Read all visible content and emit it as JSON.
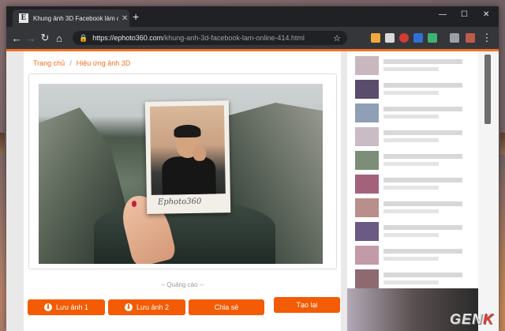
{
  "browser": {
    "tab_title": "Khung ảnh 3D Facebook làm onl",
    "url_host": "https://ephoto360.com",
    "url_path": "/khung-anh-3d-facebook-lam-online-414.html"
  },
  "breadcrumb": {
    "home": "Trang chủ",
    "separator": "/",
    "current": "Hiệu ứng ảnh 3D"
  },
  "photo": {
    "polaroid_caption": "Ephoto360"
  },
  "ad_label": "-- Quảng cáo --",
  "buttons": {
    "save1": "Lưu ảnh 1",
    "save2": "Lưu ảnh 2",
    "share": "Chia sẻ",
    "recreate": "Tạo lại"
  },
  "watermark": {
    "main": "GEN",
    "accent": "K"
  },
  "colors": {
    "accent": "#f35b04",
    "link": "#f36f21"
  }
}
